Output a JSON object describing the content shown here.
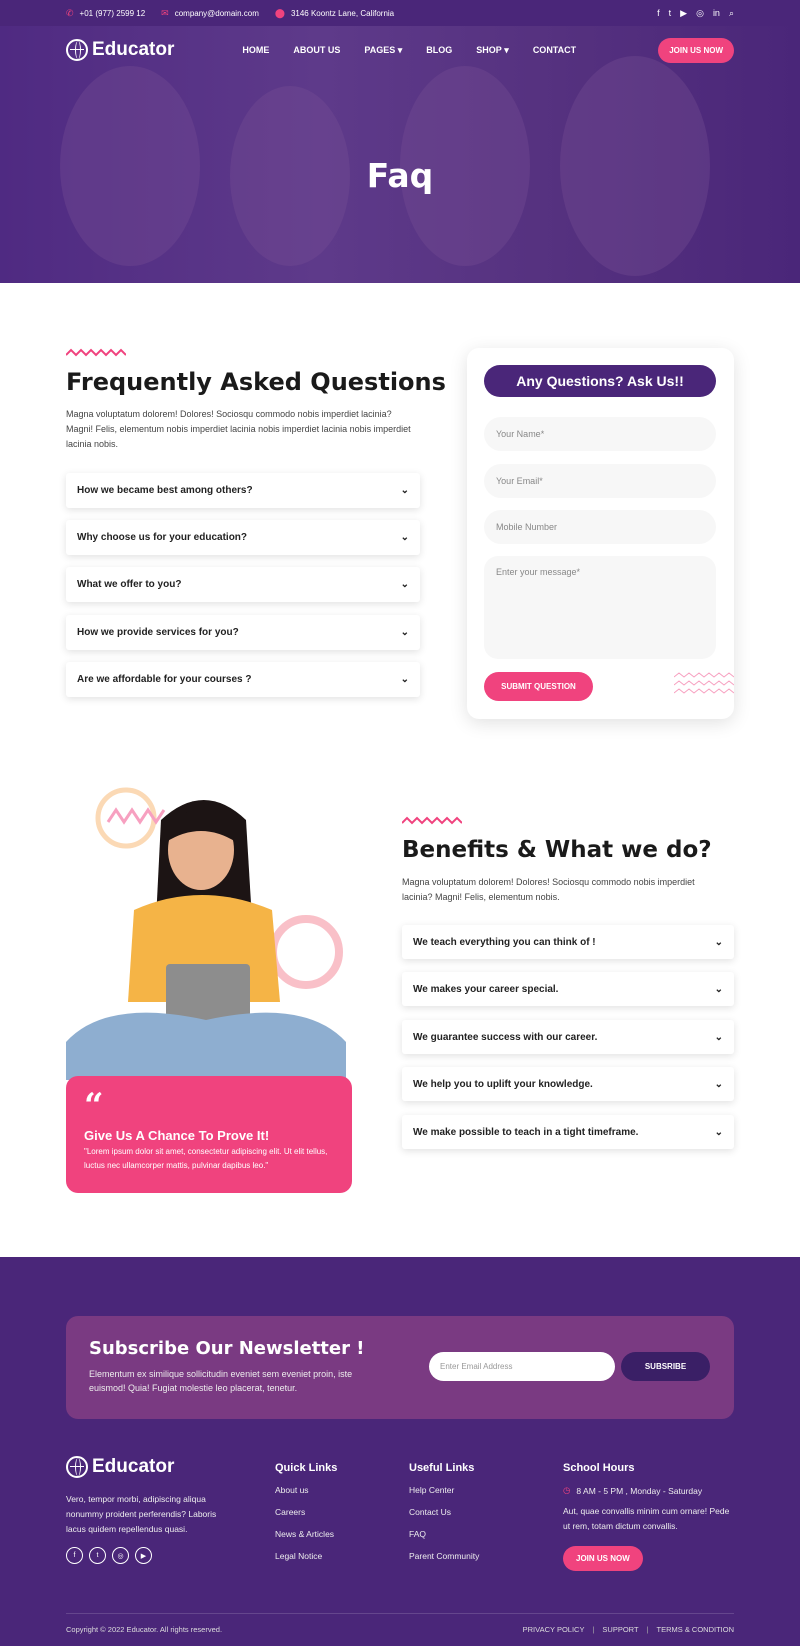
{
  "topbar": {
    "phone": "+01 (977) 2599 12",
    "email": "company@domain.com",
    "address": "3146 Koontz Lane, California",
    "social_icons": [
      "facebook-icon",
      "twitter-icon",
      "youtube-icon",
      "instagram-icon",
      "linkedin-icon",
      "search-icon"
    ]
  },
  "nav": {
    "logo": "Educator",
    "items": [
      {
        "label": "HOME"
      },
      {
        "label": "ABOUT US"
      },
      {
        "label": "PAGES",
        "dropdown": true
      },
      {
        "label": "BLOG"
      },
      {
        "label": "SHOP",
        "dropdown": true
      },
      {
        "label": "CONTACT"
      }
    ],
    "cta": "JOIN US NOW"
  },
  "hero": {
    "title": "Faq"
  },
  "faq": {
    "title": "Frequently Asked Questions",
    "text": "Magna voluptatum dolorem! Dolores! Sociosqu commodo nobis imperdiet lacinia? Magni! Felis, elementum nobis imperdiet lacinia nobis imperdiet lacinia nobis imperdiet lacinia nobis.",
    "items": [
      "How we became best among others?",
      "Why choose us for your education?",
      "What we offer to you?",
      "How we provide services for you?",
      "Are we affordable for your courses ?"
    ]
  },
  "form": {
    "title": "Any Questions? Ask Us!!",
    "name_placeholder": "Your Name*",
    "email_placeholder": "Your Email*",
    "mobile_placeholder": "Mobile Number",
    "message_placeholder": "Enter your message*",
    "submit": "SUBMIT QUESTION"
  },
  "benefits": {
    "title": "Benefits & What we do?",
    "text": "Magna voluptatum dolorem! Dolores! Sociosqu commodo nobis imperdiet lacinia? Magni! Felis, elementum nobis.",
    "items": [
      "We teach everything you can think of !",
      "We makes your career special.",
      "We guarantee success with our career.",
      "We help you to uplift your knowledge.",
      "We make possible to teach in a tight timeframe."
    ]
  },
  "quote": {
    "title": "Give Us A Chance To Prove It!",
    "text": "\"Lorem ipsum dolor sit amet, consectetur adipiscing elit. Ut elit tellus, luctus nec ullamcorper mattis, pulvinar dapibus leo.\""
  },
  "newsletter": {
    "title": "Subscribe Our Newsletter !",
    "text": "Elementum ex similique sollicitudin eveniet sem eveniet proin, iste euismod! Quia! Fugiat molestie leo placerat, tenetur.",
    "placeholder": "Enter Email Address",
    "button": "SUBSRIBE"
  },
  "footer": {
    "logo": "Educator",
    "about": "Vero, tempor morbi, adipiscing aliqua nonummy proident perferendis? Laboris lacus quidem repellendus quasi.",
    "quick_title": "Quick Links",
    "quick": [
      "About us",
      "Careers",
      "News & Articles",
      "Legal Notice"
    ],
    "useful_title": "Useful Links",
    "useful": [
      "Help Center",
      "Contact Us",
      "FAQ",
      "Parent Community"
    ],
    "hours_title": "School Hours",
    "hours": "8 AM - 5 PM , Monday - Saturday",
    "hours_text": "Aut, quae convallis minim cum ornare! Pede ut rem, totam dictum convallis.",
    "cta": "JOIN US NOW",
    "copyright": "Copyright © 2022 Educator. All rights reserved.",
    "legal": [
      "PRIVACY POLICY",
      "SUPPORT",
      "TERMS & CONDITION"
    ]
  },
  "colors": {
    "primary": "#4a2679",
    "accent": "#f0437e"
  }
}
